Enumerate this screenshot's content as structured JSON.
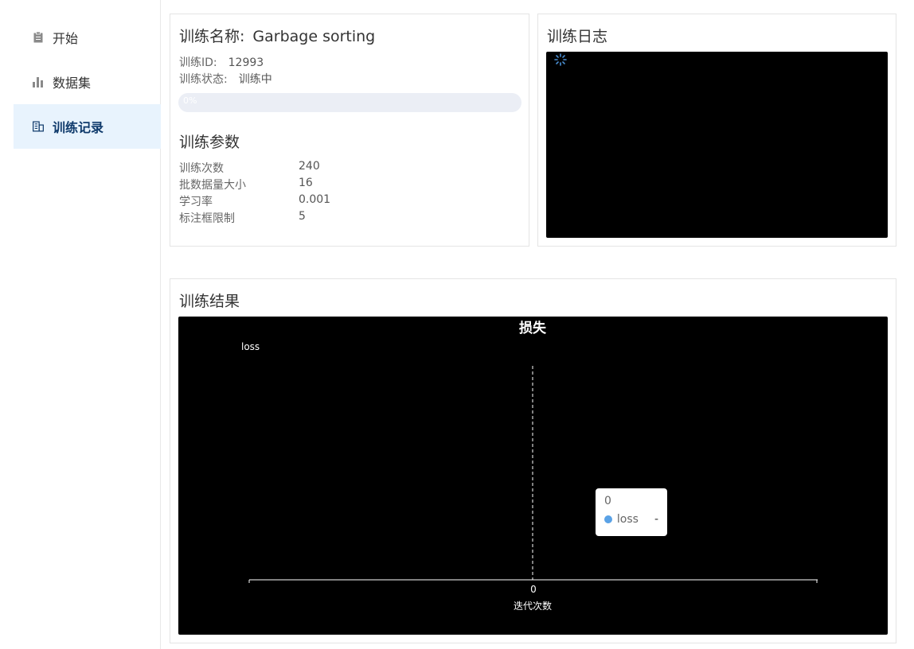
{
  "sidebar": {
    "items": [
      {
        "label": "开始",
        "icon": "clipboard-icon"
      },
      {
        "label": "数据集",
        "icon": "bar-chart-icon"
      },
      {
        "label": "训练记录",
        "icon": "building-icon",
        "active": true
      }
    ]
  },
  "info": {
    "name_label": "训练名称:",
    "name_value": "Garbage sorting",
    "id_label": "训练ID:",
    "id_value": "12993",
    "status_label": "训练状态:",
    "status_value": "训练中",
    "progress_text": "0%",
    "progress": 0
  },
  "params": {
    "title": "训练参数",
    "rows": [
      {
        "key": "训练次数",
        "value": "240"
      },
      {
        "key": "批数据量大小",
        "value": "16"
      },
      {
        "key": "学习率",
        "value": "0.001"
      },
      {
        "key": "标注框限制",
        "value": "5"
      }
    ]
  },
  "log": {
    "title": "训练日志",
    "spinner_icon": "loading-spinner-icon"
  },
  "result": {
    "title": "训练结果"
  },
  "chart_data": {
    "type": "line",
    "title": "损失",
    "xlabel": "迭代次数",
    "ylabel": "",
    "categories": [
      "0"
    ],
    "series": [
      {
        "name": "loss",
        "values": [
          null
        ]
      }
    ],
    "legend": "top-left",
    "tooltip": {
      "x": "0",
      "series": "loss",
      "value": "-"
    },
    "colors": {
      "loss": "#5aa2e6",
      "background": "#000000",
      "axis": "#ffffff"
    }
  }
}
